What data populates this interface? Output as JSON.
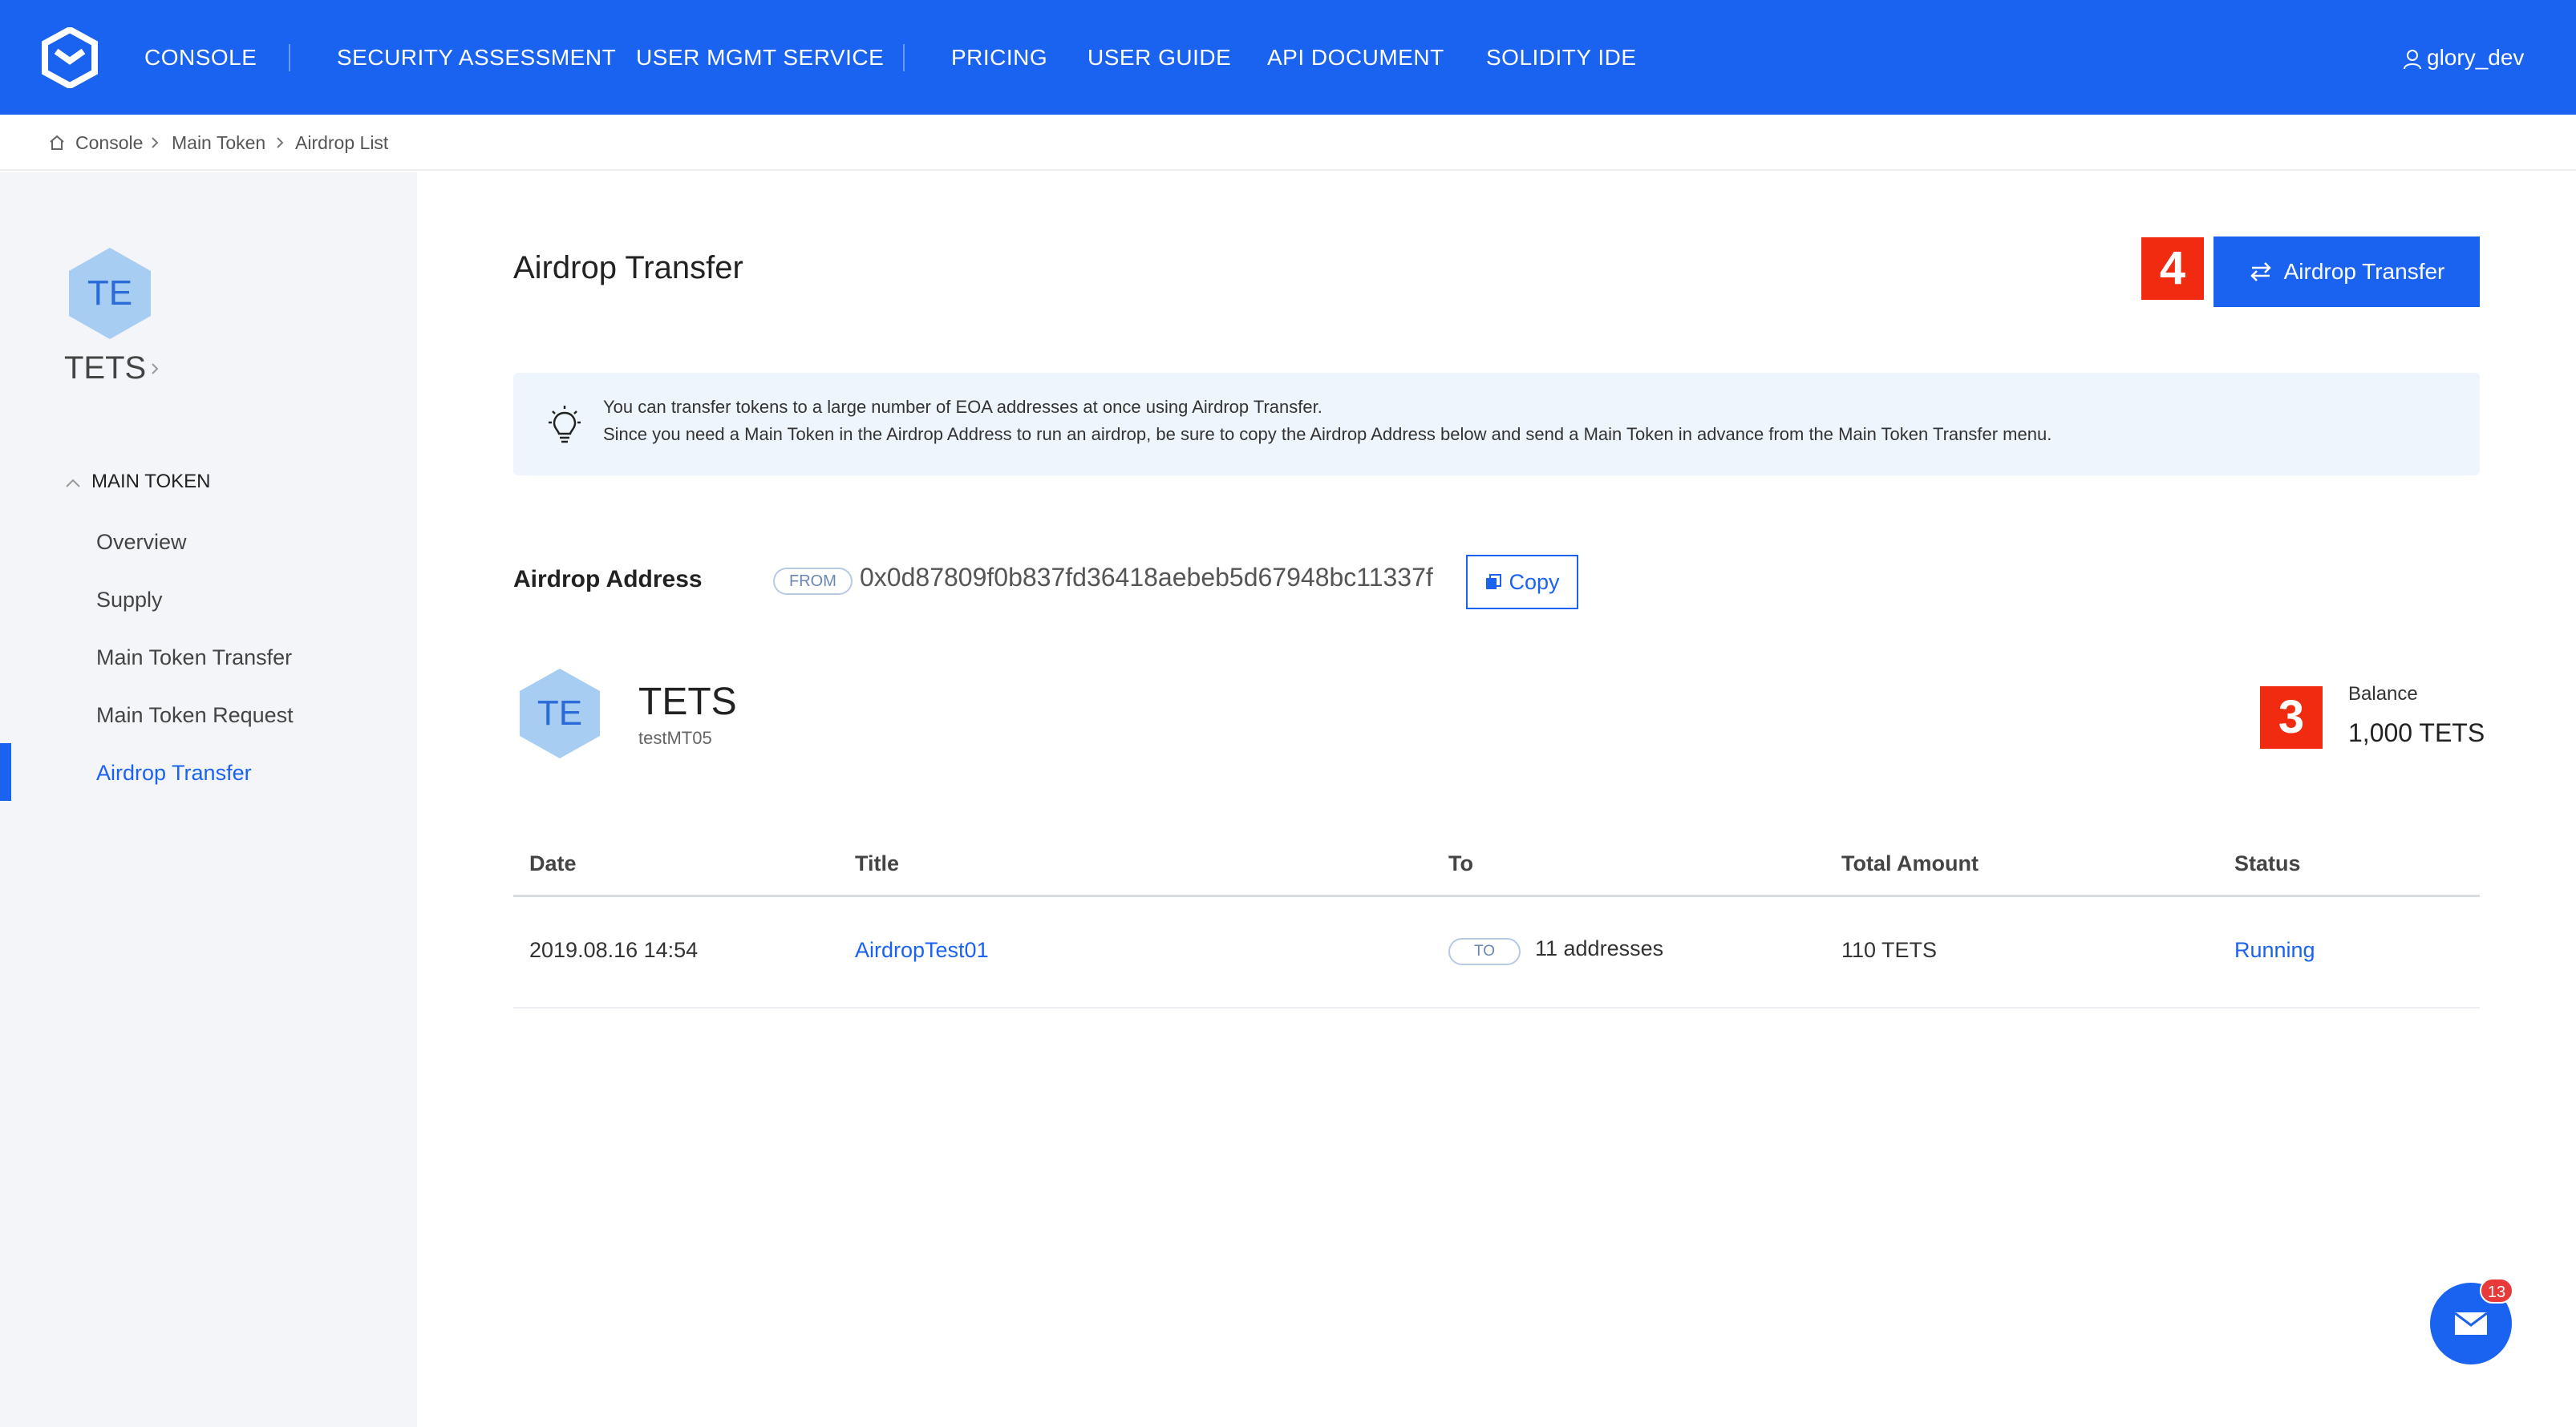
{
  "topbar": {
    "nav": [
      "CONSOLE",
      "SECURITY ASSESSMENT",
      "USER MGMT SERVICE",
      "PRICING",
      "USER GUIDE",
      "API DOCUMENT",
      "SOLIDITY IDE"
    ],
    "user": "glory_dev",
    "brand_color": "#1a62f0"
  },
  "breadcrumb": [
    "Console",
    "Main Token",
    "Airdrop List"
  ],
  "sidebar": {
    "token_initials": "TE",
    "token_name": "TETS",
    "section_title": "MAIN TOKEN",
    "items": [
      {
        "label": "Overview",
        "active": false
      },
      {
        "label": "Supply",
        "active": false
      },
      {
        "label": "Main Token Transfer",
        "active": false
      },
      {
        "label": "Main Token Request",
        "active": false
      },
      {
        "label": "Airdrop Transfer",
        "active": true
      }
    ]
  },
  "main": {
    "title": "Airdrop Transfer",
    "action_button": "Airdrop Transfer",
    "markers": {
      "action": "4",
      "balance": "3"
    },
    "info": {
      "line1": "You can transfer tokens to a large number of EOA addresses at once using Airdrop Transfer.",
      "line2": "Since you need a Main Token in the Airdrop Address to run an airdrop, be sure to copy the Airdrop Address below and send a Main Token in advance from the Main Token Transfer menu."
    },
    "airdrop_address": {
      "label": "Airdrop Address",
      "tag": "FROM",
      "value": "0x0d87809f0b837fd36418aebeb5d67948bc11337f",
      "copy_label": "Copy"
    },
    "token": {
      "initials": "TE",
      "symbol": "TETS",
      "name": "testMT05",
      "balance_label": "Balance",
      "balance": "1,000 TETS"
    },
    "table": {
      "headers": [
        "Date",
        "Title",
        "To",
        "Total Amount",
        "Status"
      ],
      "rows": [
        {
          "date": "2019.08.16 14:54",
          "title": "AirdropTest01",
          "to_tag": "TO",
          "to": "11 addresses",
          "amount": "110 TETS",
          "status": "Running"
        }
      ]
    }
  },
  "fab": {
    "badge": "13"
  },
  "colors": {
    "accent": "#1a62f0",
    "marker": "#f02b10",
    "info_bg": "#eff5fd"
  }
}
